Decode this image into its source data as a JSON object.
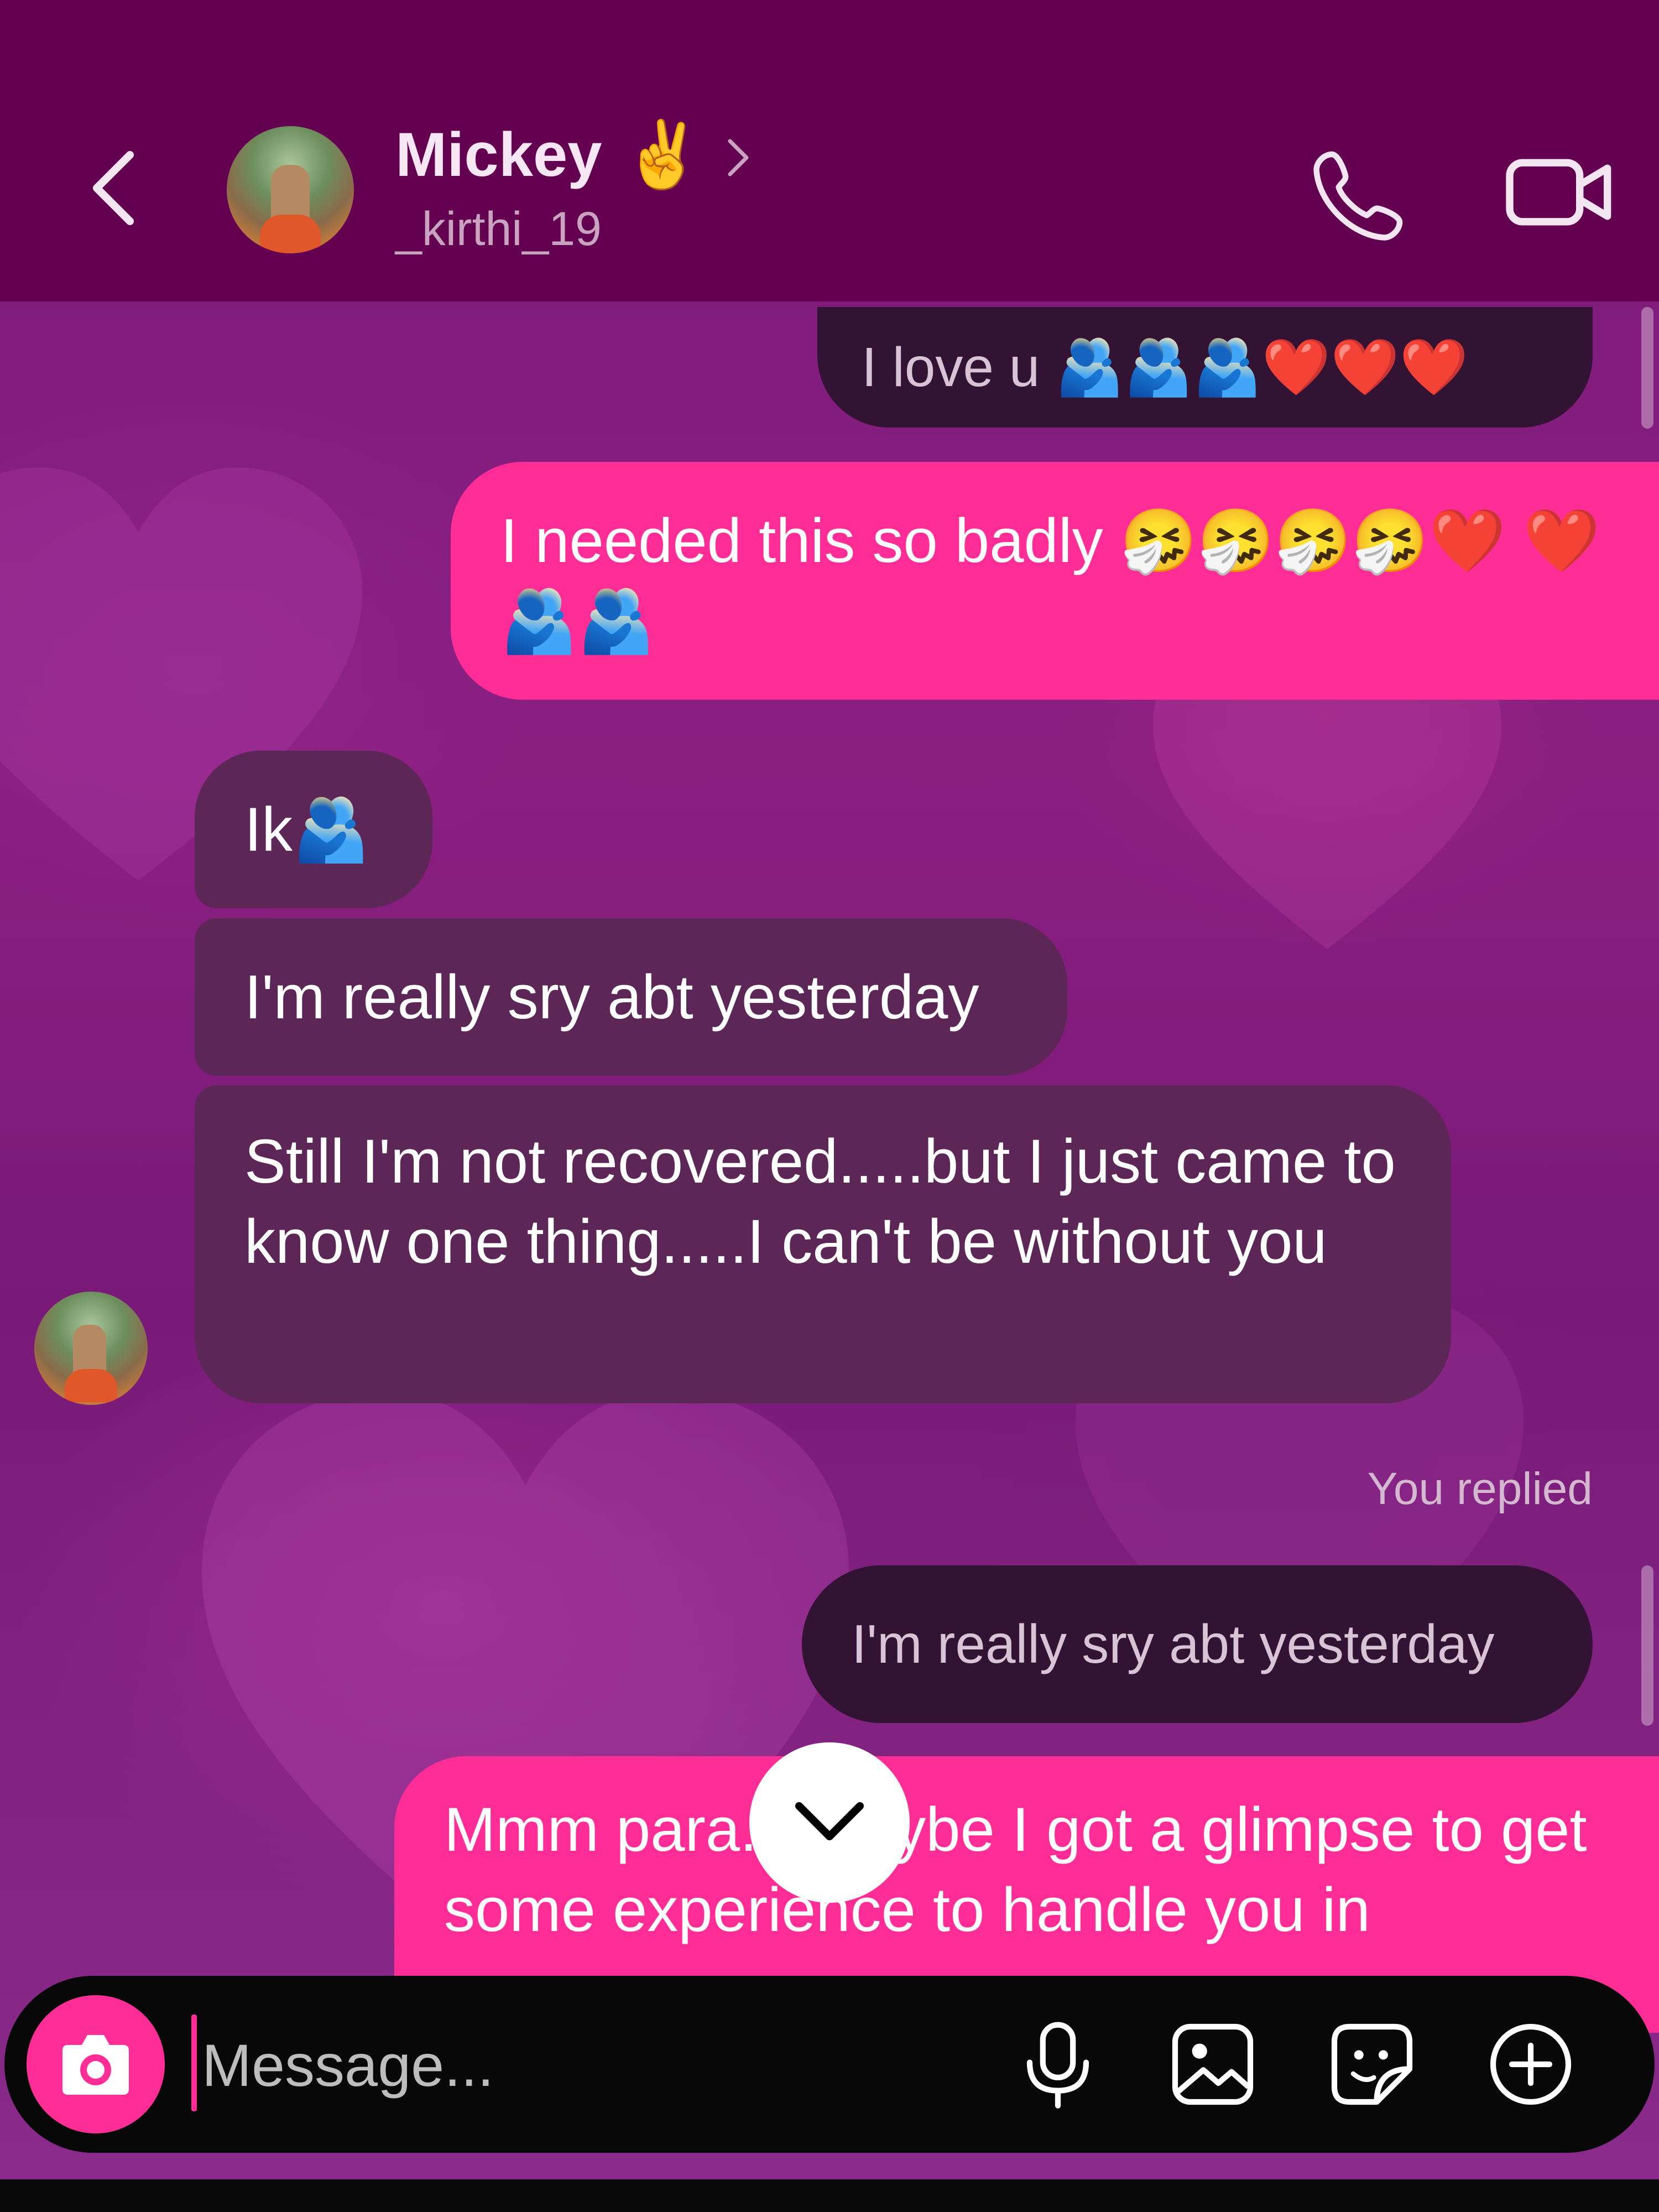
{
  "header": {
    "name": "Mickey",
    "name_emoji": "✌️",
    "username": "_kirthi_19"
  },
  "messages": [
    {
      "id": "m1",
      "side": "outgoing-quoted",
      "text": "I love u 🫂🫂🫂❤️❤️❤️"
    },
    {
      "id": "m2",
      "side": "outgoing",
      "text": "I needed this so badly 🤧🤧🤧🤧❤️ ❤️🫂🫂"
    },
    {
      "id": "m3",
      "side": "incoming",
      "text": "Ik🫂"
    },
    {
      "id": "m4",
      "side": "incoming",
      "text": "I'm really sry abt yesterday"
    },
    {
      "id": "m5",
      "side": "incoming",
      "text": "Still I'm not recovered.....but I just came to know one thing.....I can't be without you"
    },
    {
      "id": "m6",
      "side": "reply-label",
      "text": "You replied"
    },
    {
      "id": "m7",
      "side": "outgoing-quoted",
      "text": "I'm really sry abt yesterday"
    },
    {
      "id": "m8",
      "side": "outgoing",
      "text": "Mmm para... maybe I got a glimpse to get some experience to handle you in"
    }
  ],
  "composer": {
    "placeholder": "Message..."
  },
  "icons": [
    "back-chevron-icon",
    "phone-icon",
    "video-icon",
    "chevron-right-icon",
    "chevron-down-icon",
    "camera-icon",
    "microphone-icon",
    "image-icon",
    "sticker-icon",
    "plus-circle-icon"
  ],
  "colors": {
    "header_bg": "#63004f",
    "outgoing_bubble": "#ff2d95",
    "incoming_bubble": "#5c2657",
    "quoted_bubble": "#331333",
    "composer_bg": "#080808"
  }
}
